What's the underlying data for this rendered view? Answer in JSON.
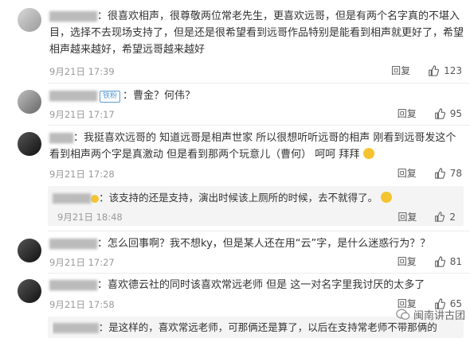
{
  "comments": [
    {
      "text": "很喜欢相声，很尊敬两位常老先生，更喜欢远哥，但是有两个名字真的不堪入目，选择不去现场支持了，但是还是很希望看到远哥作品特别是能看到相声就更好了，希望相声越来越好，希望远哥越来越好",
      "time": "9月21日 17:39",
      "reply": "回复",
      "likes": "123"
    },
    {
      "badge": "铁粉",
      "text": "曹金？何伟？",
      "time": "9月21日 17:17",
      "reply": "回复",
      "likes": "95"
    },
    {
      "text": "我挺喜欢远哥的  知道远哥是相声世家 所以很想听听远哥的相声   刚看到远哥发这个 看到相声两个字是真激动  但是看到那两个玩意儿（曹何）  呵呵   拜拜",
      "time": "9月21日 17:28",
      "reply": "回复",
      "likes": "78",
      "sub": {
        "text": "该支持的还是支持，演出时候该上厕所的时候，去不就得了。",
        "time": "9月21日 18:48",
        "reply": "回复",
        "likes": "2"
      }
    },
    {
      "text": "怎么回事啊？我不想ky，但是某人还在用“云”字，是什么迷惑行为？？",
      "time": "9月21日 17:27",
      "reply": "回复",
      "likes": "81"
    },
    {
      "text": "喜欢德云社的同时该喜欢常远老师 但是 这一对名字里我讨厌的太多了",
      "time": "9月21日 17:58",
      "reply": "回复",
      "likes": "65",
      "sub": {
        "text": "是这样的，喜欢常远老师，可那俩还是算了，以后在支持常老师不带那俩的"
      }
    }
  ],
  "watermark": "闽南讲古团"
}
